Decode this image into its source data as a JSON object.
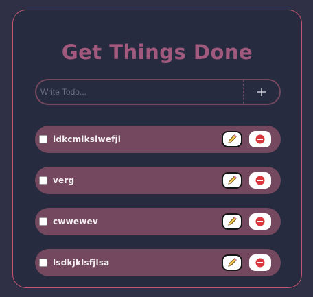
{
  "app": {
    "title": "Get Things Done"
  },
  "input": {
    "placeholder": "Write Todo...",
    "value": "",
    "add_icon": "plus-icon"
  },
  "todos": [
    {
      "text": "ldkcmlkslwefjl",
      "checked": false
    },
    {
      "text": "verg",
      "checked": false
    },
    {
      "text": "cwwewev",
      "checked": false
    },
    {
      "text": "lsdkjklsfjlsa",
      "checked": false
    }
  ],
  "icons": {
    "edit": "pencil-icon",
    "delete": "delete-icon"
  },
  "colors": {
    "background": "#2f2f45",
    "card": "#272b3f",
    "card_border": "#c2566f",
    "accent": "#a1597e",
    "item": "#74485e",
    "delete_red": "#d9363e"
  }
}
